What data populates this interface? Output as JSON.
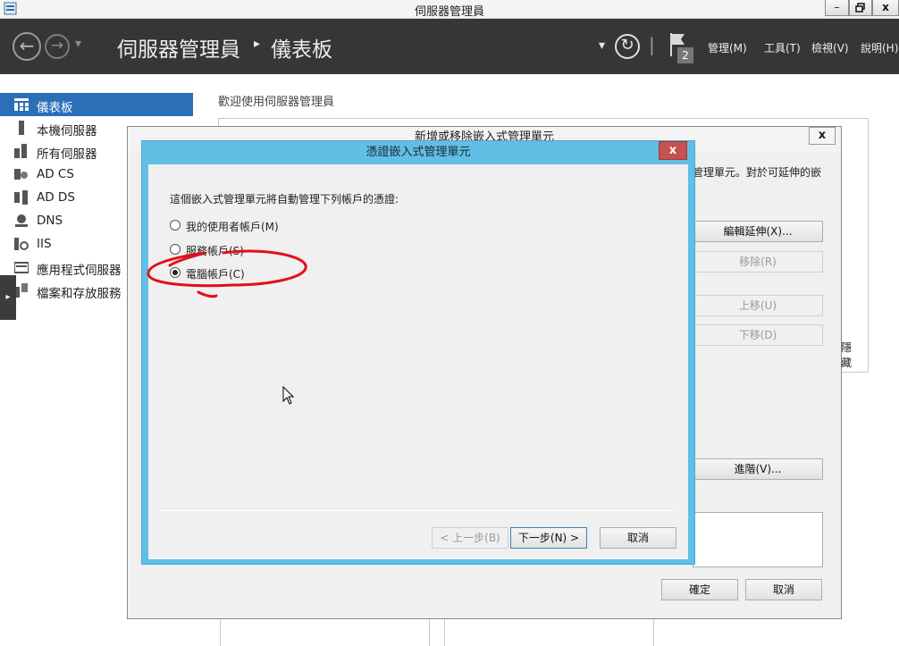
{
  "window": {
    "title": "伺服器管理員",
    "min_label": "–",
    "max_label": "❐",
    "close_label": "x"
  },
  "header": {
    "back_label": "←",
    "forward_label": "→",
    "dropdown_label": "▾",
    "breadcrumb_root": "伺服器管理員",
    "breadcrumb_sep": "▸",
    "breadcrumb_current": "儀表板",
    "refresh_dropdown": "▾",
    "refresh_label": "↻",
    "divider": "|",
    "notification_count": "2",
    "menus": [
      "管理(M)",
      "工具(T)",
      "檢視(V)",
      "說明(H)"
    ]
  },
  "sidebar": {
    "items": [
      {
        "label": "儀表板",
        "icon": "dashboard-icon",
        "active": true
      },
      {
        "label": "本機伺服器",
        "icon": "server-icon"
      },
      {
        "label": "所有伺服器",
        "icon": "servers-icon"
      },
      {
        "label": "AD CS",
        "icon": "adcs-icon"
      },
      {
        "label": "AD DS",
        "icon": "adds-icon"
      },
      {
        "label": "DNS",
        "icon": "dns-icon"
      },
      {
        "label": "IIS",
        "icon": "iis-icon"
      },
      {
        "label": "應用程式伺服器",
        "icon": "app-server-icon"
      },
      {
        "label": "檔案和存放服務",
        "icon": "file-storage-icon"
      }
    ],
    "collapse_label": "▸"
  },
  "main": {
    "welcome": "歡迎使用伺服器管理員"
  },
  "snapin_dialog": {
    "title": "新增或移除嵌入式管理單元",
    "close_label": "x",
    "description": "管理單元。對於可延伸的嵌",
    "edit_ext": "編輯延伸(X)...",
    "remove": "移除(R)",
    "move_up": "上移(U)",
    "move_down": "下移(D)",
    "hide_text": "隱藏",
    "advanced": "進階(V)...",
    "ok": "確定",
    "cancel": "取消"
  },
  "cred_dialog": {
    "title": "憑證嵌入式管理單元",
    "close_label": "x",
    "prompt": "這個嵌入式管理單元將自動管理下列帳戶的憑證:",
    "options": [
      {
        "label": "我的使用者帳戶(M)",
        "selected": false
      },
      {
        "label": "服務帳戶(S)",
        "selected": false
      },
      {
        "label": "電腦帳戶(C)",
        "selected": true
      }
    ],
    "back": "< 上一步(B)",
    "next": "下一步(N) >",
    "cancel": "取消"
  },
  "colors": {
    "header_bg": "#363636",
    "nav_active": "#2a6fb7",
    "dialog_frame": "#61bfe6",
    "close_red": "#c75050",
    "annotation_red": "#e0101c"
  }
}
